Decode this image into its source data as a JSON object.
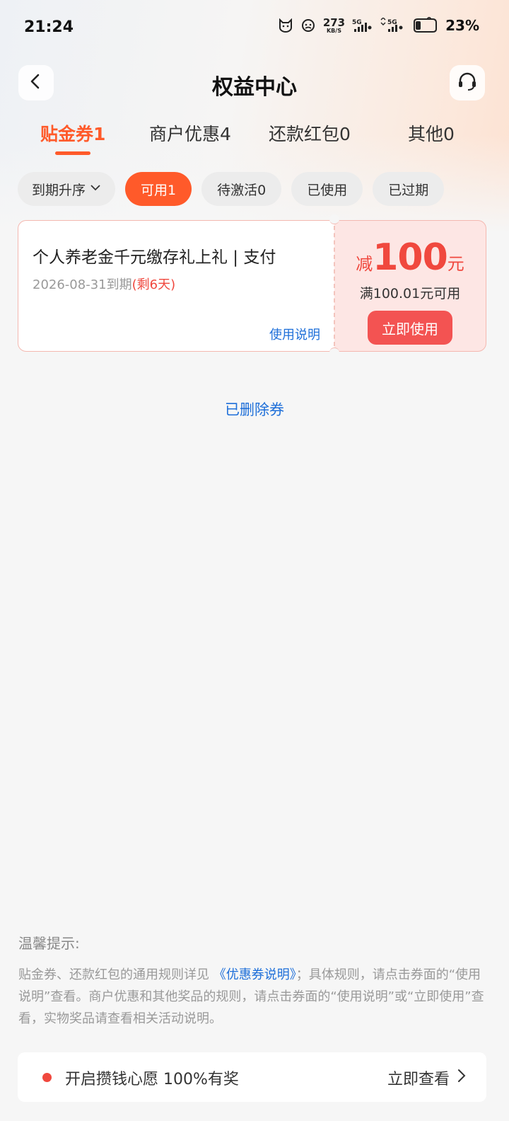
{
  "status_bar": {
    "time": "21:24",
    "net_speed_value": "273",
    "net_speed_unit": "KB/S",
    "signal1_label": "5G",
    "signal2_label": "5G",
    "battery_percent": "23%"
  },
  "header": {
    "title": "权益中心"
  },
  "tabs": [
    {
      "label": "贴金券1",
      "active": true
    },
    {
      "label": "商户优惠4",
      "active": false
    },
    {
      "label": "还款红包0",
      "active": false
    },
    {
      "label": "其他0",
      "active": false
    }
  ],
  "filters": {
    "sort_label": "到期升序",
    "chips": [
      {
        "label": "可用1",
        "active": true
      },
      {
        "label": "待激活0",
        "active": false
      },
      {
        "label": "已使用",
        "active": false
      },
      {
        "label": "已过期",
        "active": false
      }
    ]
  },
  "coupon": {
    "title": "个人养老金千元缴存礼上礼 | 支付",
    "expiry": "2026-08-31到期",
    "remaining": "(剩6天)",
    "howto_label": "使用说明",
    "amount_prefix": "减",
    "amount_value": "100",
    "amount_unit": "元",
    "condition": "满100.01元可用",
    "use_button": "立即使用"
  },
  "deleted_link": "已删除券",
  "tips": {
    "title": "温馨提示:",
    "text_before_link": "贴金券、还款红包的通用规则详见",
    "link": "《优惠券说明》",
    "text_after_link": "；具体规则，请点击券面的“使用说明”查看。商户优惠和其他奖品的规则，请点击券面的“使用说明”或“立即使用”查看，实物奖品请查看相关活动说明。"
  },
  "banner": {
    "text": "开启攒钱心愿 100%有奖",
    "action": "立即查看"
  },
  "colors": {
    "accent": "#ff5a2a",
    "coupon_red": "#f0483e",
    "link_blue": "#1e6fd9",
    "background": "#f6f6f6"
  },
  "icons": [
    "back-icon",
    "customer-service-icon",
    "chevron-down-icon",
    "chevron-right-icon",
    "battery-icon",
    "signal-icon"
  ]
}
